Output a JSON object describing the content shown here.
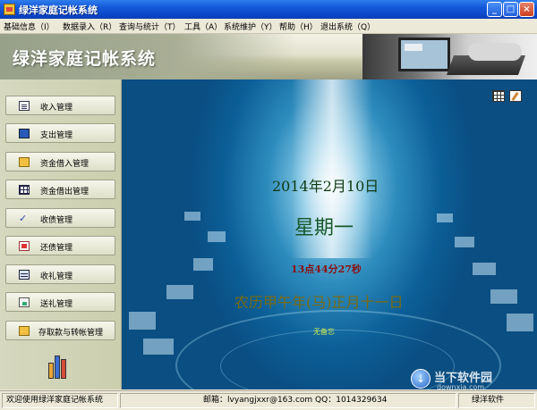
{
  "window": {
    "title": "绿洋家庭记帐系统",
    "buttons": {
      "minimize": "_",
      "maximize": "□",
      "close": "×"
    }
  },
  "menu": [
    "基础信息（I）",
    "数据录入（R）",
    "查询与统计（T）",
    "工具（A）",
    "系统维护（Y）",
    "帮助（H）",
    "退出系统（Q）"
  ],
  "banner": {
    "title": "绿洋家庭记帐系统"
  },
  "sidebar": {
    "items": [
      {
        "label": "收入管理",
        "icon": "document-icon"
      },
      {
        "label": "支出管理",
        "icon": "ledger-icon"
      },
      {
        "label": "资金借入管理",
        "icon": "folder-icon"
      },
      {
        "label": "资金借出管理",
        "icon": "grid-icon"
      },
      {
        "label": "收债管理",
        "icon": "check-icon"
      },
      {
        "label": "还债管理",
        "icon": "receipt-icon"
      },
      {
        "label": "收礼管理",
        "icon": "table-icon"
      },
      {
        "label": "送礼管理",
        "icon": "card-icon"
      },
      {
        "label": "存取款与转帐管理",
        "icon": "folder-icon"
      }
    ]
  },
  "main": {
    "date": "2014年2月10日",
    "weekday": "星期一",
    "time": "13点44分27秒",
    "lunar": "农历甲午年(马)正月十一日",
    "memo": "无备忘"
  },
  "watermark": {
    "text": "当下软件园",
    "sub": "downxia.com"
  },
  "status": {
    "welcome": "欢迎使用绿洋家庭记帐系统",
    "contact": "邮箱：lvyangjxxr@163.com  QQ：1014329634",
    "company": "绿洋软件"
  },
  "colors": {
    "titlebar": "#0a44c6",
    "main_background": "#0c5f98",
    "date": "#0e3a12",
    "weekday": "#16582a",
    "time": "#8a1010",
    "lunar": "#7a6a10",
    "memo": "#d4f04a"
  }
}
